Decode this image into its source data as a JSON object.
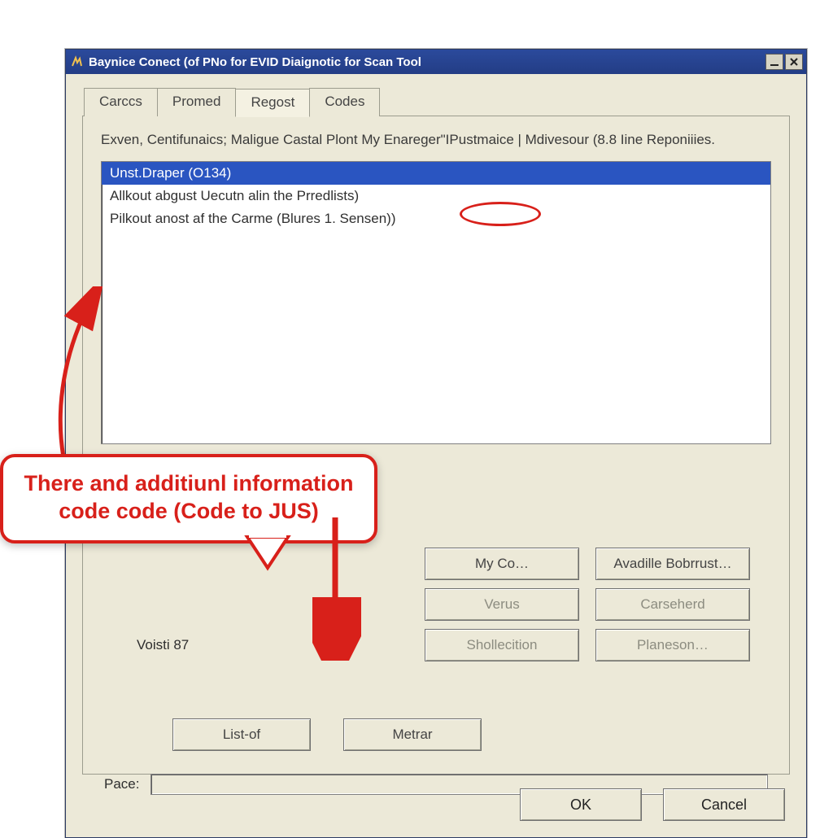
{
  "titlebar": {
    "title": "Baynice Conect (of PNo for EVID Diaignotic for Scan Tool"
  },
  "tabs": [
    "Carccs",
    "Promed",
    "Regost",
    "Codes"
  ],
  "active_tab_index": 2,
  "description": "Exven, Centifunaics; Maligue Castal Plont My Enareger\"IPustmaice | Mdivesour (8.8 Iine Reponiiies.",
  "list_items": [
    "Unst.Draper  (O134)",
    "Allkout abgust Uecutn alin the Prredlists)",
    "Pilkout anost af the Carme (Blures 1. Sensen))"
  ],
  "selected_index": 0,
  "buttons_grid": {
    "myco": "My Co…",
    "avadille": "Avadille Bobrrust…",
    "verus": "Verus",
    "carseherd": "Carseherd",
    "shollecition": "Shollecition",
    "planeson": "Planeson…"
  },
  "voisti_label": "Voisti 87",
  "bottom_buttons": {
    "listof": "List-of",
    "metrar": "Metrar"
  },
  "pace_label": "Pace:",
  "footer": {
    "ok": "OK",
    "cancel": "Cancel"
  },
  "callout_line1": "There and additiunl information",
  "callout_line2": "code code (Code to JUS)"
}
